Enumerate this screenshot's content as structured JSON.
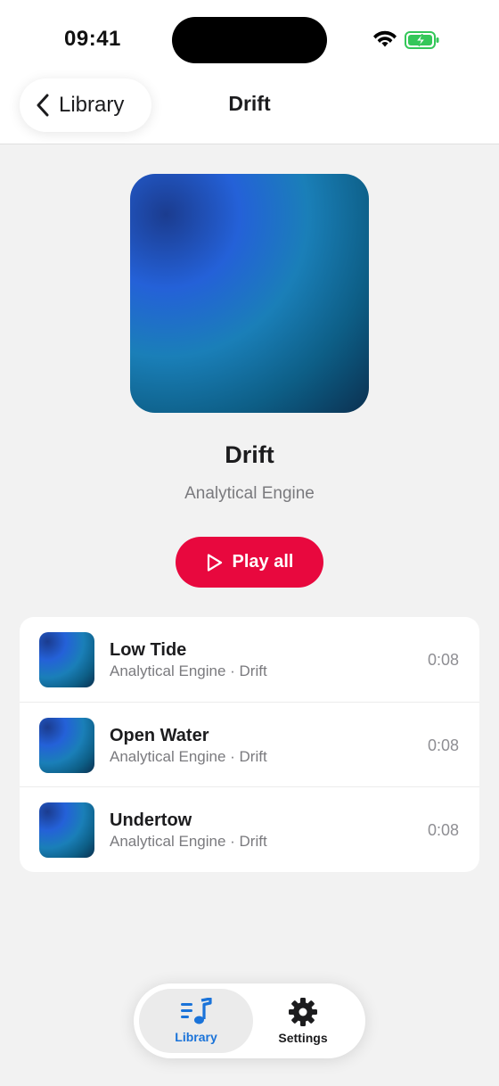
{
  "status_bar": {
    "time": "09:41"
  },
  "nav": {
    "back_label": "Library",
    "title": "Drift"
  },
  "album": {
    "title": "Drift",
    "artist": "Analytical Engine",
    "play_label": "Play all"
  },
  "tracks": [
    {
      "title": "Low Tide",
      "subtitle": "Analytical Engine · Drift",
      "duration": "0:08"
    },
    {
      "title": "Open Water",
      "subtitle": "Analytical Engine · Drift",
      "duration": "0:08"
    },
    {
      "title": "Undertow",
      "subtitle": "Analytical Engine · Drift",
      "duration": "0:08"
    }
  ],
  "tabs": [
    {
      "label": "Library",
      "icon": "music-list-icon",
      "selected": true
    },
    {
      "label": "Settings",
      "icon": "gear-icon",
      "selected": false
    }
  ],
  "colors": {
    "accent": "#e8083e",
    "tab_active": "#1a73d9",
    "battery": "#34c759"
  }
}
